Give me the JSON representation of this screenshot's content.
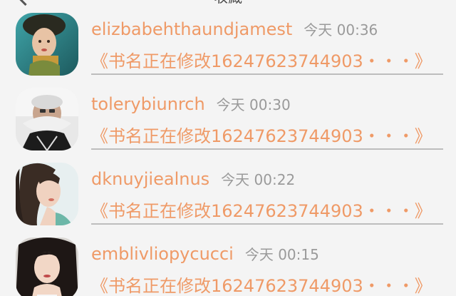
{
  "header": {
    "title": "收藏"
  },
  "items": [
    {
      "username": "elizbabehthaundjamest",
      "time": "今天 00:36",
      "book": "《书名正在修改16247623744903・・・》"
    },
    {
      "username": "tolerybiunrch",
      "time": "今天 00:30",
      "book": "《书名正在修改16247623744903・・・》"
    },
    {
      "username": "dknuyjiealnus",
      "time": "今天 00:22",
      "book": "《书名正在修改16247623744903・・・》"
    },
    {
      "username": "emblivliopycucci",
      "time": "今天 00:15",
      "book": "《书名正在修改16247623744903・・・》"
    }
  ],
  "colors": {
    "accent": "#ef9a67",
    "time": "#9a9a9a",
    "divider": "#bdbdbd",
    "background": "#f4f4f4"
  }
}
